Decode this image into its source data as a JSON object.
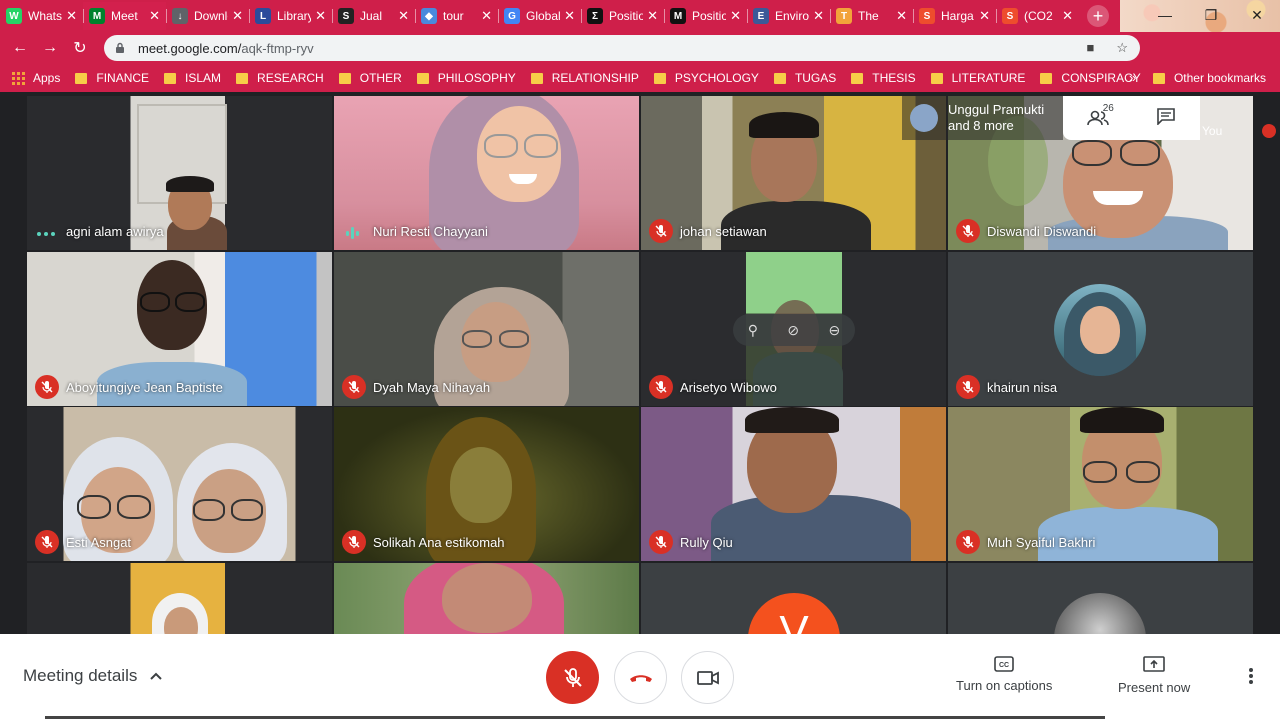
{
  "tabs": [
    {
      "title": "WhatsApp",
      "fav_color": "#25d366",
      "fav_glyph": "W",
      "active": false
    },
    {
      "title": "Meet",
      "fav_color": "#00832d",
      "fav_glyph": "M",
      "active": true
    },
    {
      "title": "Downloads",
      "fav_color": "#5f6368",
      "fav_glyph": "↓",
      "active": false
    },
    {
      "title": "Library",
      "fav_color": "#2b4b9b",
      "fav_glyph": "L",
      "active": false
    },
    {
      "title": "Jual",
      "fav_color": "#222222",
      "fav_glyph": "S",
      "active": false
    },
    {
      "title": "tour",
      "fav_color": "#4a89dc",
      "fav_glyph": "◆",
      "active": false
    },
    {
      "title": "Global",
      "fav_color": "#4285f4",
      "fav_glyph": "G",
      "active": false
    },
    {
      "title": "Position",
      "fav_color": "#111111",
      "fav_glyph": "Σ",
      "active": false
    },
    {
      "title": "Position",
      "fav_color": "#111111",
      "fav_glyph": "M",
      "active": false
    },
    {
      "title": "Environment",
      "fav_color": "#3b5998",
      "fav_glyph": "E",
      "active": false
    },
    {
      "title": "The",
      "fav_color": "#f2a33a",
      "fav_glyph": "T",
      "active": false
    },
    {
      "title": "Harga",
      "fav_color": "#ee4d2d",
      "fav_glyph": "S",
      "active": false
    },
    {
      "title": "(CO2",
      "fav_color": "#ee4d2d",
      "fav_glyph": "S",
      "active": false
    }
  ],
  "url": {
    "host": "meet.google.com/",
    "path": "aqk-ftmp-ryv"
  },
  "bookmarks": {
    "apps": "Apps",
    "folders": [
      "FINANCE",
      "ISLAM",
      "RESEARCH",
      "OTHER",
      "PHILOSOPHY",
      "RELATIONSHIP",
      "PSYCHOLOGY",
      "TUGAS",
      "THESIS",
      "LITERATURE",
      "CONSPIRACY"
    ],
    "more": "»",
    "other": "Other bookmarks"
  },
  "participants": [
    {
      "name": "agni alam awirya",
      "status": "dots"
    },
    {
      "name": "Nuri Resti Chayyani",
      "status": "speaking"
    },
    {
      "name": "johan setiawan",
      "status": "muted"
    },
    {
      "name": "Diswandi Diswandi",
      "status": "muted"
    },
    {
      "name": "Aboyitungiye Jean Baptiste",
      "status": "muted"
    },
    {
      "name": "Dyah Maya Nihayah",
      "status": "muted"
    },
    {
      "name": "Arisetyo Wibowo",
      "status": "muted"
    },
    {
      "name": "khairun nisa",
      "status": "muted"
    },
    {
      "name": "Esti Asngat",
      "status": "muted"
    },
    {
      "name": "Solikah Ana estikomah",
      "status": "muted"
    },
    {
      "name": "Rully Qiu",
      "status": "muted"
    },
    {
      "name": "Muh Syaiful Bakhri",
      "status": "muted"
    }
  ],
  "overlay": {
    "line1": "Unggul Pramukti",
    "line2": "and 8 more",
    "count": "26",
    "you": "You"
  },
  "bottom": {
    "meeting_details": "Meeting details",
    "captions": "Turn on captions",
    "present": "Present now"
  },
  "colors": {
    "chrome": "#cf1f4a",
    "mute_red": "#d93025",
    "speaking": "#5bd3bd"
  }
}
